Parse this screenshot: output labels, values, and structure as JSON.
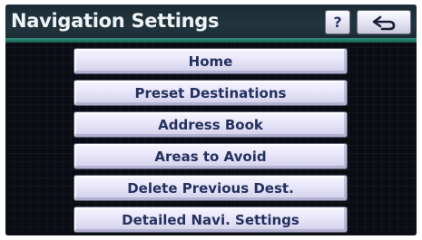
{
  "header": {
    "title": "Navigation Settings",
    "help_label": "?",
    "back_icon": "back-arrow-icon"
  },
  "menu": {
    "items": [
      {
        "label": "Home"
      },
      {
        "label": "Preset Destinations"
      },
      {
        "label": "Address Book"
      },
      {
        "label": "Areas to Avoid"
      },
      {
        "label": "Delete Previous Dest."
      },
      {
        "label": "Detailed Navi. Settings"
      }
    ]
  },
  "colors": {
    "header_bg": "#1f3039",
    "accent_line": "#2f8f7e",
    "button_face": "#e8e6fa",
    "button_text": "#24315f",
    "screen_bg": "#0a0c14"
  }
}
